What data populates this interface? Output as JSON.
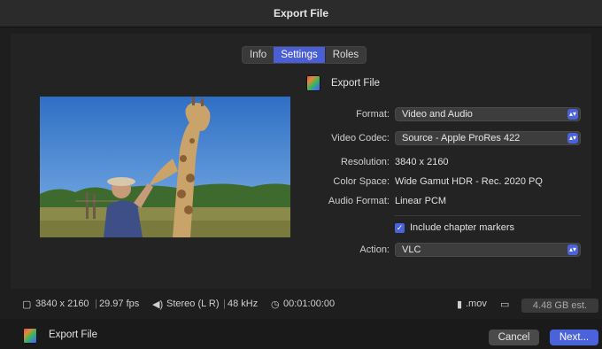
{
  "window": {
    "title": "Export File"
  },
  "tabs": [
    {
      "label": "Info",
      "active": false
    },
    {
      "label": "Settings",
      "active": true
    },
    {
      "label": "Roles",
      "active": false
    }
  ],
  "destination": {
    "label": "Export File",
    "icon": "export-file-icon"
  },
  "settings": {
    "format": {
      "label": "Format:",
      "value": "Video and Audio"
    },
    "video_codec": {
      "label": "Video Codec:",
      "value": "Source - Apple ProRes 422"
    },
    "resolution": {
      "label": "Resolution:",
      "value": "3840 x 2160"
    },
    "color_space": {
      "label": "Color Space:",
      "value": "Wide Gamut HDR - Rec. 2020 PQ"
    },
    "audio_format": {
      "label": "Audio Format:",
      "value": "Linear PCM"
    },
    "chapter_markers": {
      "label": "Include chapter markers",
      "checked": true
    },
    "action": {
      "label": "Action:",
      "value": "VLC"
    }
  },
  "status": {
    "resolution": "3840 x 2160",
    "fps": "29.97 fps",
    "audio": "Stereo (L R)",
    "sample_rate": "48 kHz",
    "duration": "00:01:00:00",
    "extension": ".mov",
    "size_estimate": "4.48 GB est."
  },
  "footer": {
    "label": "Export File",
    "cancel_label": "Cancel",
    "next_label": "Next..."
  },
  "colors": {
    "accent": "#4a63db",
    "background": "#1e1e1e"
  }
}
